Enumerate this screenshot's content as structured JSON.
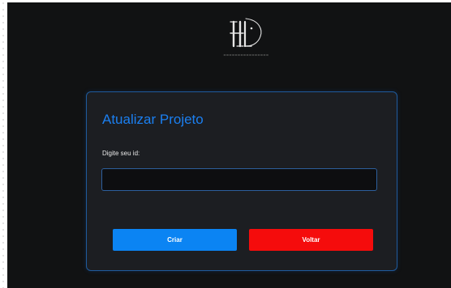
{
  "form": {
    "title": "Atualizar Projeto",
    "id_label": "Digite seu id:",
    "id_value": "",
    "create_label": "Criar",
    "back_label": "Voltar"
  },
  "colors": {
    "accent": "#1b7ff0",
    "create_button": "#0b84f3",
    "back_button": "#f50c0c",
    "card_border": "#1f5a9c",
    "background": "#111213"
  }
}
